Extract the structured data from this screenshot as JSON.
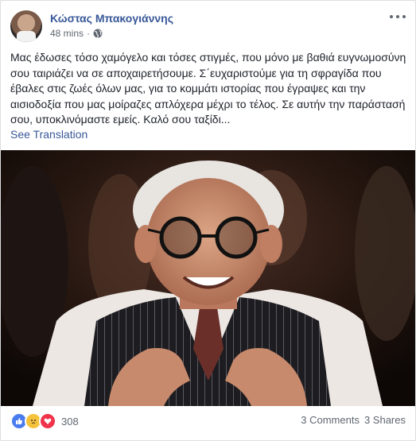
{
  "post": {
    "author": "Κώστας Μπακογιάννης",
    "time": "48 mins",
    "privacy_icon": "globe-icon",
    "text": "Μας έδωσες τόσο χαμόγελο και τόσες στιγμές, που μόνο με βαθιά ευγνωμοσύνη σου ταιριάζει να σε αποχαιρετήσουμε. Σ΄ευχαριστούμε για τη σφραγίδα που έβαλες στις ζωές όλων μας, για το κομμάτι ιστορίας που έγραψες και την αισιοδοξία που μας μοίραζες απλόχερα μέχρι το τέλος. Σε αυτήν την παράστασή σου, υποκλινόμαστε εμείς. Καλό σου ταξίδι...",
    "see_translation": "See Translation",
    "photo_alt": "",
    "reactions": {
      "icons": [
        "like-icon",
        "sad-icon",
        "love-icon"
      ],
      "count": "308"
    },
    "comments": "3 Comments",
    "shares": "3 Shares"
  },
  "colors": {
    "link": "#385898",
    "meta": "#616770",
    "like": "#4a7cf0",
    "sad": "#f5c33b",
    "love": "#f0324a"
  }
}
